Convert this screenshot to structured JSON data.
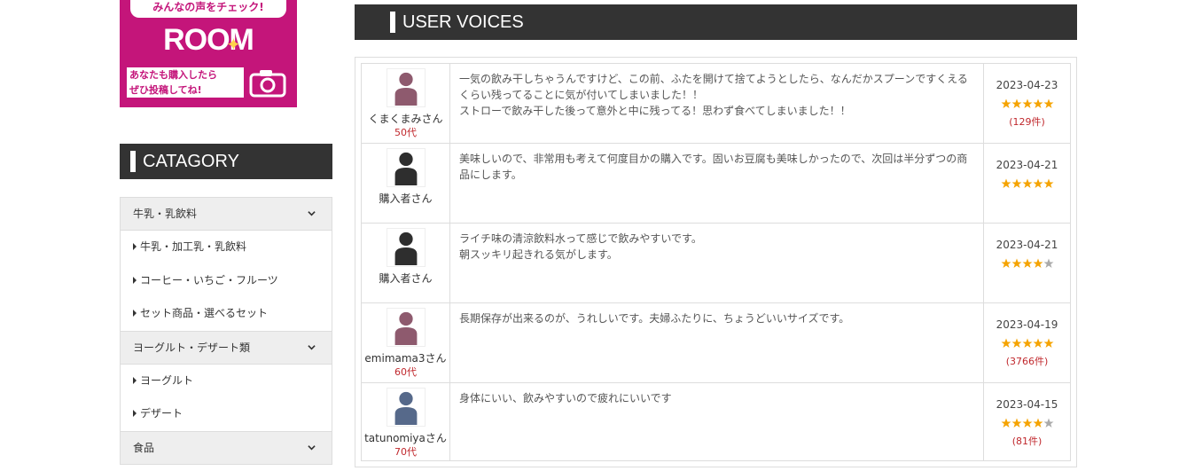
{
  "banner": {
    "catch_text": "みんなの声をチェック!",
    "logo_text": "ROOM",
    "invite_line1": "あなたも購入したら",
    "invite_line2": "ぜひ投稿してね!"
  },
  "category": {
    "title": "CATAGORY",
    "groups": [
      {
        "label": "牛乳・乳飲料",
        "items": [
          "牛乳・加工乳・乳飲料",
          "コーヒー・いちご・フルーツ",
          "セット商品・選べるセット"
        ]
      },
      {
        "label": "ヨーグルト・デザート類",
        "items": [
          "ヨーグルト",
          "デザート"
        ]
      },
      {
        "label": "食品",
        "items": []
      }
    ]
  },
  "voices": {
    "title": "USER VOICES",
    "colors": {
      "star_on": "#f5a300",
      "star_off": "#aaaaaa",
      "accent_red": "#c0282d"
    },
    "reviews": [
      {
        "user": "くまくまみさん",
        "age": "50代",
        "avatar_color": "#8e5a6e",
        "text": "一気の飲み干しちゃうんですけど、この前、ふたを開けて捨てようとしたら、なんだかスプーンですくえるくらい残ってることに気が付いてしまいました！！\nストローで飲み干した後って意外と中に残ってる！思わず食べてしまいました！！",
        "date": "2023-04-23",
        "rating": 5,
        "count": "(129件)"
      },
      {
        "user": "購入者さん",
        "age": "",
        "avatar_color": "#2e2e2e",
        "text": "美味しいので、非常用も考えて何度目かの購入です。固いお豆腐も美味しかったので、次回は半分ずつの商品にします。",
        "date": "2023-04-21",
        "rating": 5,
        "count": ""
      },
      {
        "user": "購入者さん",
        "age": "",
        "avatar_color": "#2e2e2e",
        "text": "ライチ味の清涼飲料水って感じで飲みやすいです。\n朝スッキリ起きれる気がします。",
        "date": "2023-04-21",
        "rating": 4,
        "count": ""
      },
      {
        "user": "emimama3さん",
        "age": "60代",
        "avatar_color": "#8e5a6e",
        "text": "長期保存が出来るのが、うれしいです。夫婦ふたりに、ちょうどいいサイズです。",
        "date": "2023-04-19",
        "rating": 5,
        "count": "(3766件)"
      },
      {
        "user": "tatunomiyaさん",
        "age": "70代",
        "avatar_color": "#56698a",
        "text": "身体にいい、飲みやすいので疲れにいいです",
        "date": "2023-04-15",
        "rating": 4,
        "count": "(81件)"
      }
    ]
  }
}
